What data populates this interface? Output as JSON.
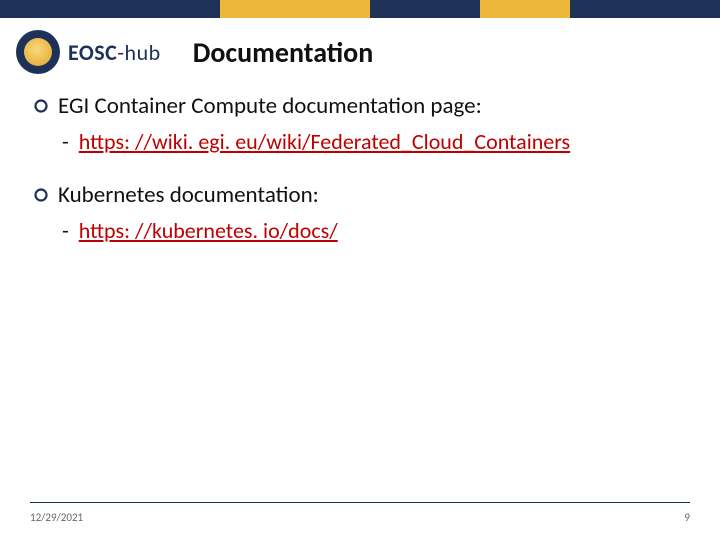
{
  "logo": {
    "brand": "EOSC",
    "suffix": "-hub"
  },
  "title": "Documentation",
  "items": [
    {
      "heading": "EGI Container Compute documentation page:",
      "dash": "-",
      "link": "https: //wiki. egi. eu/wiki/Federated_Cloud_Containers"
    },
    {
      "heading": "Kubernetes documentation:",
      "dash": "-",
      "link": "https: //kubernetes. io/docs/"
    }
  ],
  "footer": {
    "date": "12/29/2021",
    "page": "9"
  }
}
